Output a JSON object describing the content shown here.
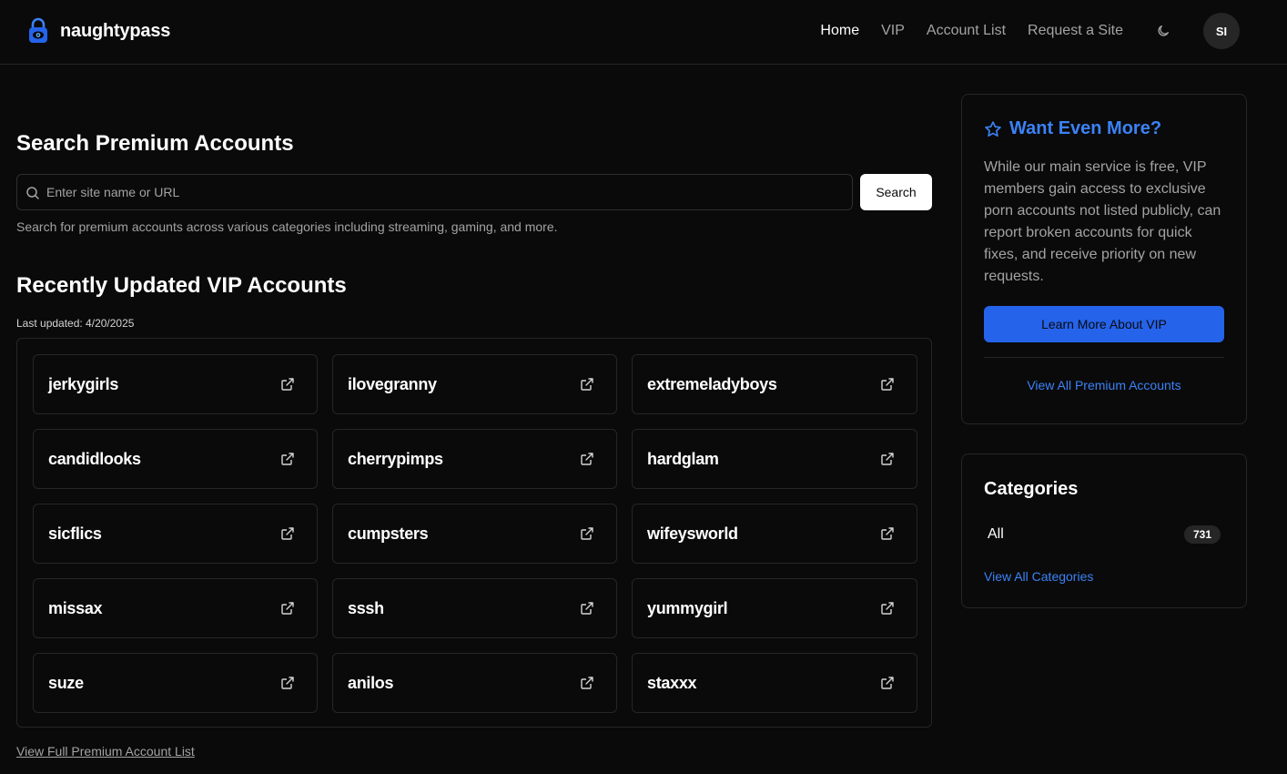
{
  "brand": {
    "name": "naughtypass",
    "logo_icon": "padlock-eye-icon"
  },
  "nav": {
    "items": [
      {
        "label": "Home",
        "active": true
      },
      {
        "label": "VIP",
        "active": false
      },
      {
        "label": "Account List",
        "active": false
      },
      {
        "label": "Request a Site",
        "active": false
      }
    ],
    "theme_icon": "moon-icon",
    "avatar_initials": "SI"
  },
  "search": {
    "title": "Search Premium Accounts",
    "placeholder": "Enter site name or URL",
    "value": "",
    "button_label": "Search",
    "help_text": "Search for premium accounts across various categories including streaming, gaming, and more."
  },
  "recent": {
    "title": "Recently Updated VIP Accounts",
    "last_updated": "Last updated: 4/20/2025",
    "accounts": [
      "jerkygirls",
      "ilovegranny",
      "extremeladyboys",
      "candidlooks",
      "cherrypimps",
      "hardglam",
      "sicflics",
      "cumpsters",
      "wifeysworld",
      "missax",
      "sssh",
      "yummygirl",
      "suze",
      "anilos",
      "staxxx"
    ],
    "view_full_label": "View Full Premium Account List"
  },
  "vip_card": {
    "title": "Want Even More?",
    "text": "While our main service is free, VIP members gain access to exclusive porn accounts not listed publicly, can report broken accounts for quick fixes, and receive priority on new requests.",
    "button_label": "Learn More About VIP",
    "link_label": "View All Premium Accounts"
  },
  "categories": {
    "title": "Categories",
    "items": [
      {
        "name": "All",
        "count": "731"
      }
    ],
    "view_all_label": "View All Categories"
  },
  "colors": {
    "background": "#0a0a0a",
    "accent": "#3b82f6",
    "button_blue": "#2563eb",
    "border": "#262626",
    "muted_text": "#a3a3a3"
  }
}
